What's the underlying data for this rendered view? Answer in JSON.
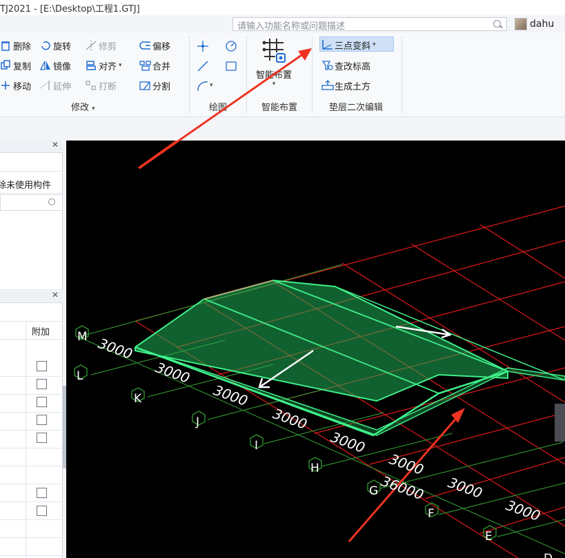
{
  "window": {
    "title": "TJ2021 - [E:\\Desktop\\工程1.GTJ]"
  },
  "search": {
    "placeholder": "请输入功能名称或问题描述"
  },
  "user": {
    "name": "dahu"
  },
  "ribbon": {
    "modify": {
      "items": [
        {
          "label": "删除",
          "icon": "delete-icon",
          "enabled": true
        },
        {
          "label": "复制",
          "icon": "copy-icon",
          "enabled": true
        },
        {
          "label": "移动",
          "icon": "move-icon",
          "enabled": true
        },
        {
          "label": "旋转",
          "icon": "rotate-icon",
          "enabled": true
        },
        {
          "label": "镜像",
          "icon": "mirror-icon",
          "enabled": true
        },
        {
          "label": "延伸",
          "icon": "extend-icon",
          "enabled": false
        },
        {
          "label": "修剪",
          "icon": "trim-icon",
          "enabled": false
        },
        {
          "label": "对齐",
          "icon": "align-icon",
          "enabled": true
        },
        {
          "label": "打断",
          "icon": "break-icon",
          "enabled": false
        },
        {
          "label": "偏移",
          "icon": "offset-icon",
          "enabled": true
        },
        {
          "label": "合并",
          "icon": "merge-icon",
          "enabled": true
        },
        {
          "label": "分割",
          "icon": "split-icon",
          "enabled": true
        }
      ],
      "group_label": "修改"
    },
    "draw": {
      "group_label": "绘图"
    },
    "smart_layout": {
      "button_label": "智能布置",
      "group_label": "智能布置"
    },
    "cushion_edit": {
      "items": [
        {
          "label": "三点变斜",
          "icon": "three-point-slope-icon",
          "selected": true
        },
        {
          "label": "查改标高",
          "icon": "check-elevation-icon",
          "selected": false
        },
        {
          "label": "生成土方",
          "icon": "generate-earthwork-icon",
          "selected": false
        }
      ],
      "group_label": "垫层二次编辑"
    }
  },
  "left_panel": {
    "delete_unused": "除未使用构件",
    "column_header": "附加",
    "checkbox_count": 7
  },
  "viewport": {
    "background": "#000000",
    "grid_color": "#e01a1a",
    "axis_color": "#2e8b2e",
    "slab_color": "#2ecf6a",
    "axis_labels": [
      "M",
      "L",
      "K",
      "J",
      "I",
      "H",
      "G",
      "F",
      "E",
      "D"
    ],
    "dimension_labels": [
      "3000",
      "3000",
      "3000",
      "3000",
      "3000",
      "3000",
      "36000",
      "3000",
      "3000"
    ]
  }
}
